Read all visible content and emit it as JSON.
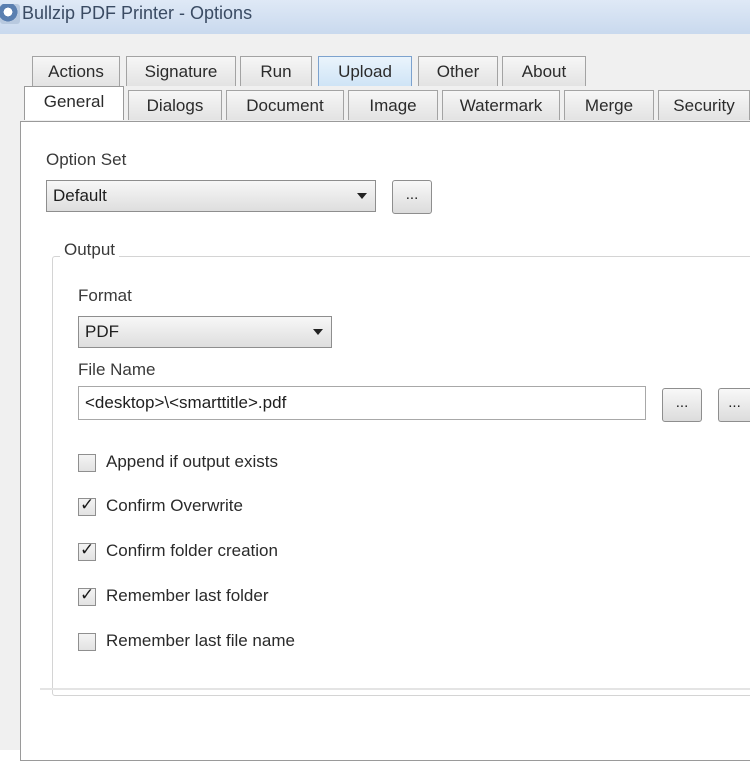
{
  "window": {
    "title": "Bullzip PDF Printer - Options"
  },
  "tabs_row1": [
    "Actions",
    "Signature",
    "Run",
    "Upload",
    "Other",
    "About"
  ],
  "tabs_row2": [
    "General",
    "Dialogs",
    "Document",
    "Image",
    "Watermark",
    "Merge",
    "Security"
  ],
  "option_set": {
    "label": "Option Set",
    "value": "Default",
    "button": "..."
  },
  "output": {
    "group_label": "Output",
    "format_label": "Format",
    "format_value": "PDF",
    "file_name_label": "File Name",
    "file_name_value": "<desktop>\\<smarttitle>.pdf",
    "browse_button": "...",
    "extra_button": "..."
  },
  "checkboxes": [
    {
      "label": "Append if output exists",
      "checked": false
    },
    {
      "label": "Confirm Overwrite",
      "checked": true
    },
    {
      "label": "Confirm folder creation",
      "checked": true
    },
    {
      "label": "Remember last folder",
      "checked": true
    },
    {
      "label": "Remember last file name",
      "checked": false
    }
  ]
}
